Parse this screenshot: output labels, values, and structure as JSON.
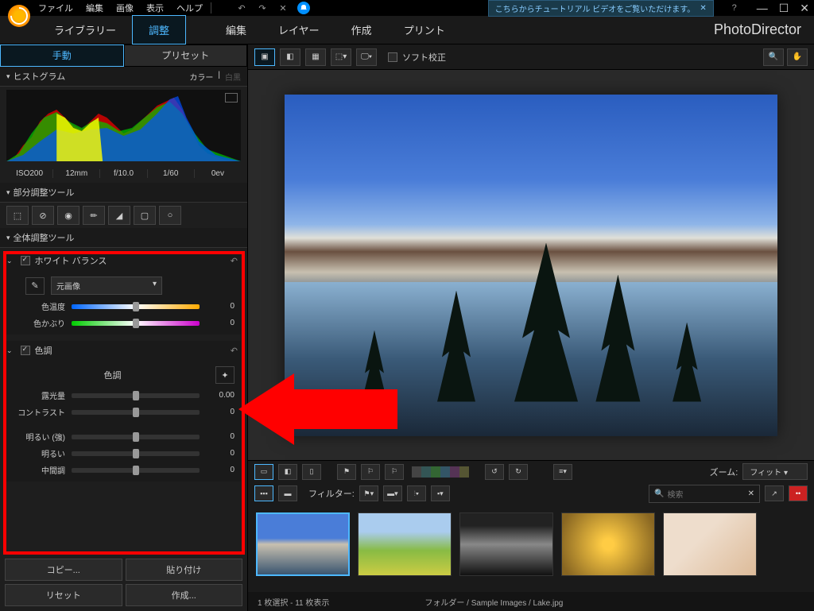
{
  "menu": {
    "file": "ファイル",
    "edit": "編集",
    "image": "画像",
    "view": "表示",
    "help": "ヘルプ"
  },
  "promo": "こちらからチュートリアル ビデオをご覧いただけます。",
  "brand": "PhotoDirector",
  "mainTabs": {
    "library": "ライブラリー",
    "adjust": "調整",
    "edit": "編集",
    "layer": "レイヤー",
    "create": "作成",
    "print": "プリント"
  },
  "subTabs": {
    "manual": "手動",
    "preset": "プリセット"
  },
  "histogram": {
    "title": "ヒストグラム",
    "color": "カラー",
    "bw": "白黒"
  },
  "exif": {
    "iso": "ISO200",
    "focal": "12mm",
    "aperture": "f/10.0",
    "shutter": "1/60",
    "ev": "0ev"
  },
  "localTools": "部分調整ツール",
  "globalTools": "全体調整ツール",
  "wb": {
    "title": "ホワイト バランス",
    "preset": "元画像",
    "temp": "色温度",
    "tempVal": "0",
    "tint": "色かぶり",
    "tintVal": "0"
  },
  "tone": {
    "title": "色調",
    "sub": "色調",
    "exposure": "露光量",
    "exposureVal": "0.00",
    "contrast": "コントラスト",
    "contrastVal": "0",
    "brightHigh": "明るい (強)",
    "brightHighVal": "0",
    "bright": "明るい",
    "brightVal": "0",
    "mid": "中間調",
    "midVal": "0"
  },
  "buttons": {
    "copy": "コピー...",
    "paste": "貼り付け",
    "reset": "リセット",
    "create": "作成..."
  },
  "softProof": "ソフト校正",
  "filterLabel": "フィルター:",
  "zoomLabel": "ズーム:",
  "zoomValue": "フィット",
  "searchPlaceholder": "検索",
  "status": {
    "selection": "1 枚選択 - 11 枚表示",
    "path": "フォルダー / Sample Images / Lake.jpg"
  }
}
